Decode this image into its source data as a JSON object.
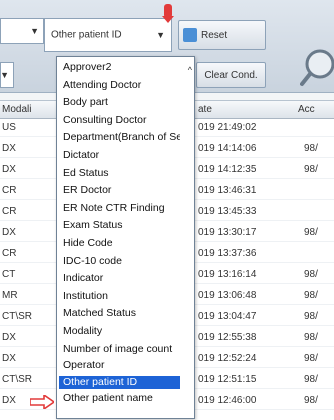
{
  "toolbar": {
    "field_combo_value": "Other patient ID",
    "reset_label": "Reset",
    "clear_cond_label": "Clear Cond."
  },
  "grid": {
    "headers": [
      "Modali",
      "ate",
      "Acc"
    ],
    "rows": [
      {
        "modality": "US",
        "date": "019 21:49:02",
        "acc": ""
      },
      {
        "modality": "DX",
        "date": "019 14:14:06",
        "acc": "98/"
      },
      {
        "modality": "DX",
        "date": "019 14:12:35",
        "acc": "98/"
      },
      {
        "modality": "CR",
        "date": "019 13:46:31",
        "acc": ""
      },
      {
        "modality": "CR",
        "date": "019 13:45:33",
        "acc": ""
      },
      {
        "modality": "DX",
        "date": "019 13:30:17",
        "acc": "98/"
      },
      {
        "modality": "CR",
        "date": "019 13:37:36",
        "acc": ""
      },
      {
        "modality": "CT",
        "date": "019 13:16:14",
        "acc": "98/"
      },
      {
        "modality": "MR",
        "date": "019 13:06:48",
        "acc": "98/"
      },
      {
        "modality": "CT\\SR",
        "date": "019 13:04:47",
        "acc": "98/"
      },
      {
        "modality": "DX",
        "date": "019 12:55:38",
        "acc": "98/"
      },
      {
        "modality": "DX",
        "date": "019 12:52:24",
        "acc": "98/"
      },
      {
        "modality": "CT\\SR",
        "date": "019 12:51:15",
        "acc": "98/"
      },
      {
        "modality": "DX",
        "date": "019 12:46:00",
        "acc": "98/"
      }
    ]
  },
  "dropdown": {
    "options": [
      "Approver2",
      "Attending Doctor",
      "Body part",
      "Consulting Doctor",
      "Department(Branch of Servi",
      "Dictator",
      "Ed Status",
      "ER Doctor",
      "ER Note CTR Finding",
      "Exam Status",
      "Hide Code",
      "IDC-10 code",
      "Indicator",
      "Institution",
      "Matched Status",
      "Modality",
      "Number of image count",
      "Operator",
      "Other patient ID",
      "Other patient name"
    ],
    "selected_index": 18
  },
  "colors": {
    "selection": "#1d63d6",
    "marker": "#e23a3a"
  }
}
